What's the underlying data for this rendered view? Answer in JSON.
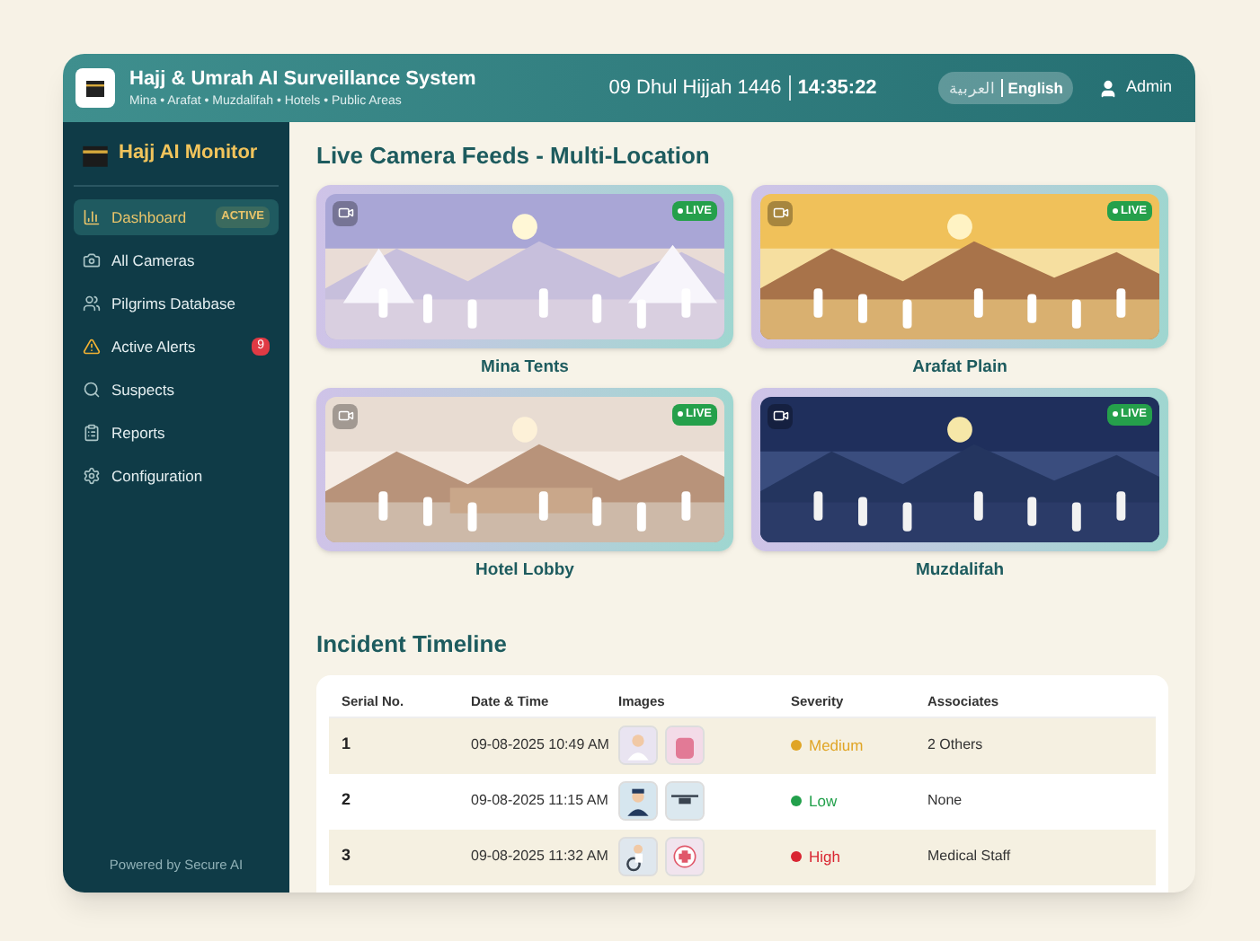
{
  "header": {
    "title": "Hajj & Umrah AI Surveillance System",
    "subtitle": "Mina • Arafat • Muzdalifah • Hotels • Public Areas",
    "date": "09 Dhul Hijjah 1446",
    "time": "14:35:22",
    "languages": [
      {
        "label": "العربية",
        "selected": false
      },
      {
        "label": "English",
        "selected": true
      }
    ],
    "user": "Admin"
  },
  "sidebar": {
    "brand": "Hajj AI Monitor",
    "items": [
      {
        "label": "Dashboard",
        "selected": true,
        "tag": "ACTIVE"
      },
      {
        "label": "All Cameras",
        "selected": false
      },
      {
        "label": "Pilgrims Database",
        "selected": false
      },
      {
        "label": "Active Alerts",
        "selected": false,
        "badge": "9"
      },
      {
        "label": "Suspects",
        "selected": false
      },
      {
        "label": "Reports",
        "selected": false
      },
      {
        "label": "Configuration",
        "selected": false
      }
    ],
    "footer": "Powered by Secure AI"
  },
  "feeds": {
    "title": "Live Camera Feeds - Multi-Location",
    "items": [
      {
        "name": "Mina Tents",
        "status": "LIVE",
        "kind": "picture"
      },
      {
        "name": "Arafat Plain",
        "status": "LIVE",
        "kind": "picture"
      },
      {
        "name": "Hotel Lobby",
        "status": "LIVE",
        "kind": "picture"
      },
      {
        "name": "Muzdalifah",
        "status": "LIVE",
        "kind": "picture"
      }
    ]
  },
  "timeline": {
    "title": "Incident Timeline",
    "columns": [
      "Serial No.",
      "Date & Time",
      "Images",
      "Severity",
      "Associates"
    ],
    "rows": [
      {
        "serial": "1",
        "datetime": "09-08-2025 10:49 AM",
        "severity": "Medium",
        "color": "#e0a526",
        "associates": "2 Others"
      },
      {
        "serial": "2",
        "datetime": "09-08-2025 11:15 AM",
        "severity": "Low",
        "color": "#22a04b",
        "associates": "None"
      },
      {
        "serial": "3",
        "datetime": "09-08-2025 11:32 AM",
        "severity": "High",
        "color": "#d92632",
        "associates": "Medical Staff"
      }
    ]
  }
}
